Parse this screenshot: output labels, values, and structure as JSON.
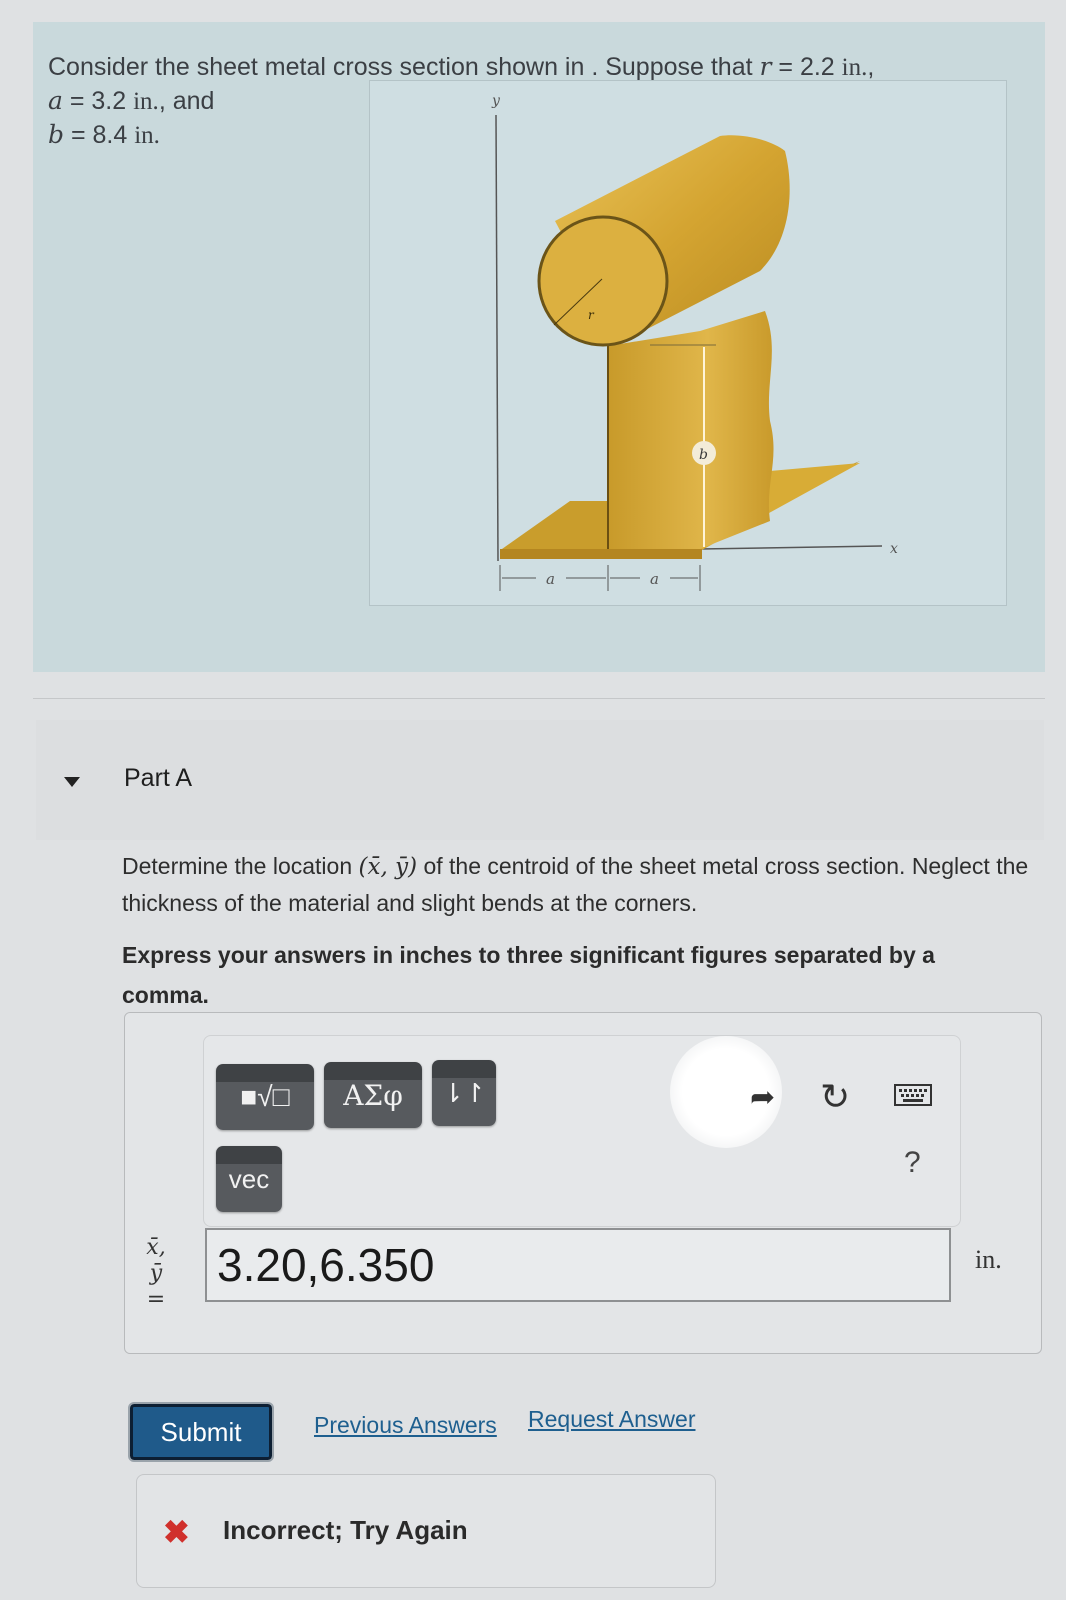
{
  "problem": {
    "intro_prefix": "Consider the sheet metal cross section shown in . Suppose that ",
    "r_symbol": "r",
    "r_value": " = 2.2 ",
    "a_symbol": "a",
    "a_value": " = 3.2 ",
    "a_suffix": ", and",
    "b_symbol": "b",
    "b_value": " = 8.4 ",
    "unit": "in.",
    "r_suffix": ","
  },
  "figure": {
    "axis_y_label": "y",
    "axis_x_label": "x",
    "radius_label": "r",
    "height_label": "b",
    "dim_left_label": "a",
    "dim_right_label": "a",
    "sheet_color": "#d8a932",
    "sheet_dark": "#a67a1c",
    "sheet_light": "#e8c155"
  },
  "part": {
    "title": "Part A",
    "expanded": true,
    "question_prefix": "Determine the location ",
    "question_math": "(x̄, ȳ)",
    "question_suffix": " of the centroid of the sheet metal cross section. Neglect the thickness of the material and slight bends at the corners.",
    "instruction": "Express your answers in inches to three significant figures separated by a comma."
  },
  "toolbar": {
    "templates_label": "■√□",
    "greek_label": "ΑΣφ",
    "arrows_label": "⇂↾",
    "vec_label": "vec",
    "redo_icon": "redo-icon",
    "reset_icon": "reset-icon",
    "keyboard_icon": "keyboard-icon",
    "help_label": "?"
  },
  "answer": {
    "var_x": "x̄,",
    "var_y": "ȳ",
    "equals": "=",
    "value": "3.20,6.350",
    "unit": "in."
  },
  "actions": {
    "submit": "Submit",
    "previous_answers": "Previous Answers",
    "request_answer": "Request Answer"
  },
  "feedback": {
    "status": "incorrect",
    "icon": "✖",
    "message": "Incorrect; Try Again",
    "color": "#d0302c"
  }
}
